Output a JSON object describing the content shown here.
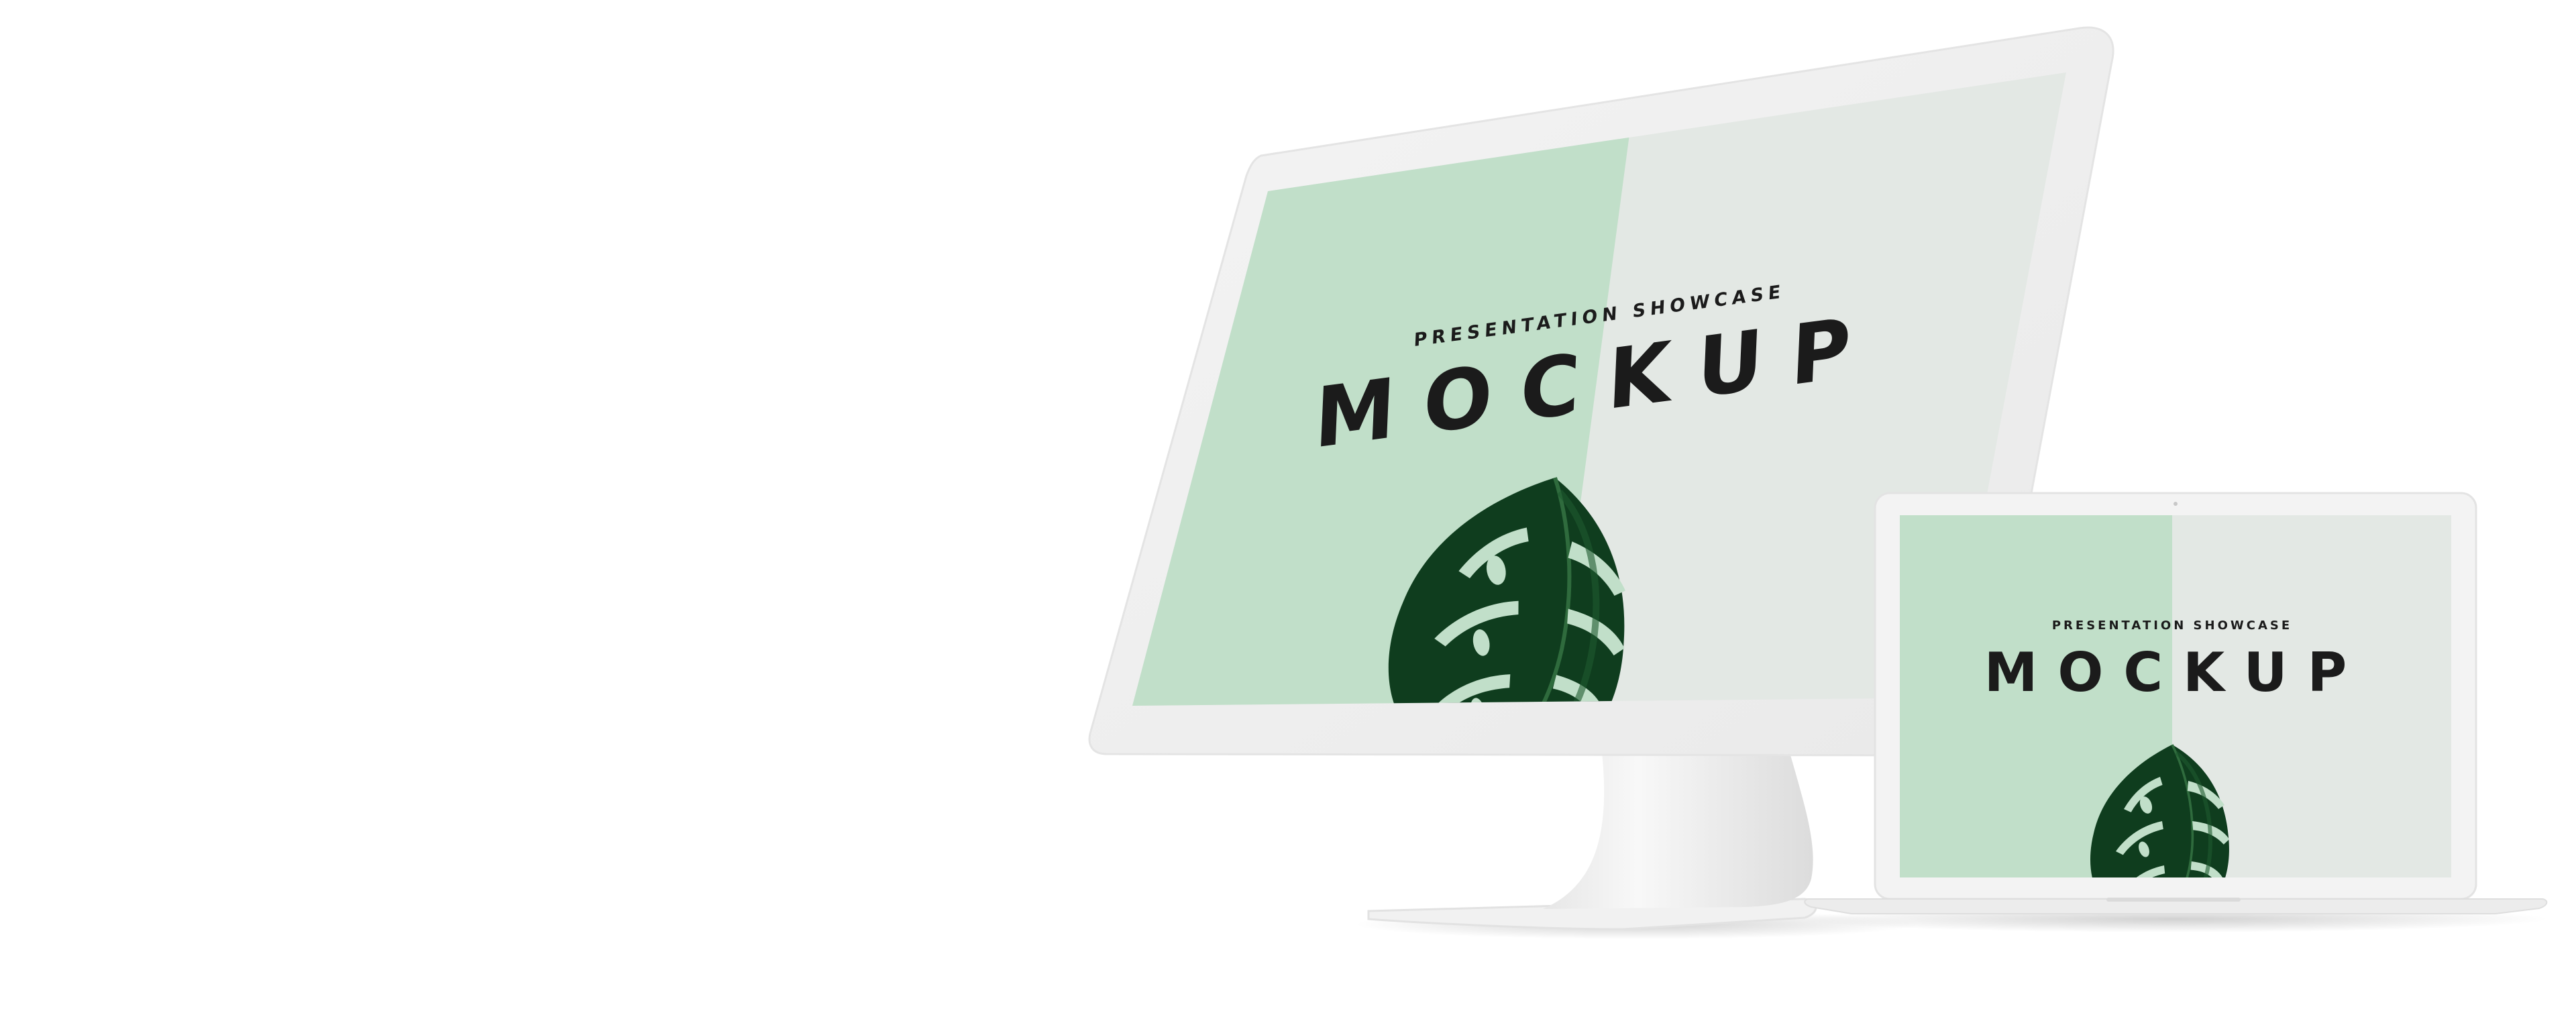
{
  "monitor_screen": {
    "kicker": "PRESENTATION SHOWCASE",
    "headline": "MOCKUP"
  },
  "laptop_screen": {
    "kicker": "PRESENTATION SHOWCASE",
    "headline": "MOCKUP"
  },
  "colors": {
    "background": "#ffffff",
    "device_frame": "#f0f0f0",
    "screen_green": "#c1dfc9",
    "screen_grey": "#e3e8e4",
    "leaf_dark": "#0d3a1c",
    "leaf_mid": "#1e5a2e",
    "text": "#1b1b1b"
  },
  "icons": {
    "leaf": "monstera-leaf-icon",
    "camera": "camera-dot-icon"
  }
}
